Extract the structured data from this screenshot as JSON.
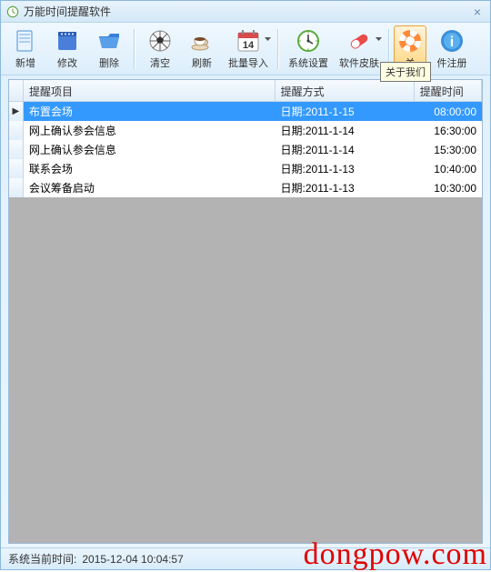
{
  "window": {
    "title": "万能时间提醒软件"
  },
  "toolbar": {
    "new": "新增",
    "edit": "修改",
    "delete": "删除",
    "clear": "清空",
    "refresh": "刷新",
    "batch_import": "批量导入",
    "settings": "系统设置",
    "skin": "软件皮肤",
    "about_partial": "关",
    "register": "件注册"
  },
  "tooltip": "关于我们",
  "columns": {
    "item": "提醒项目",
    "method": "提醒方式",
    "time": "提醒时间"
  },
  "rows": [
    {
      "item": "布置会场",
      "method": "日期:2011-1-15",
      "time": "08:00:00",
      "selected": true
    },
    {
      "item": "网上确认参会信息",
      "method": "日期:2011-1-14",
      "time": "16:30:00",
      "selected": false
    },
    {
      "item": "网上确认参会信息",
      "method": "日期:2011-1-14",
      "time": "15:30:00",
      "selected": false
    },
    {
      "item": "联系会场",
      "method": "日期:2011-1-13",
      "time": "10:40:00",
      "selected": false
    },
    {
      "item": "会议筹备启动",
      "method": "日期:2011-1-13",
      "time": "10:30:00",
      "selected": false
    }
  ],
  "status": {
    "label": "系统当前时间:",
    "value": "2015-12-04 10:04:57"
  },
  "watermark": "dongpow.com"
}
